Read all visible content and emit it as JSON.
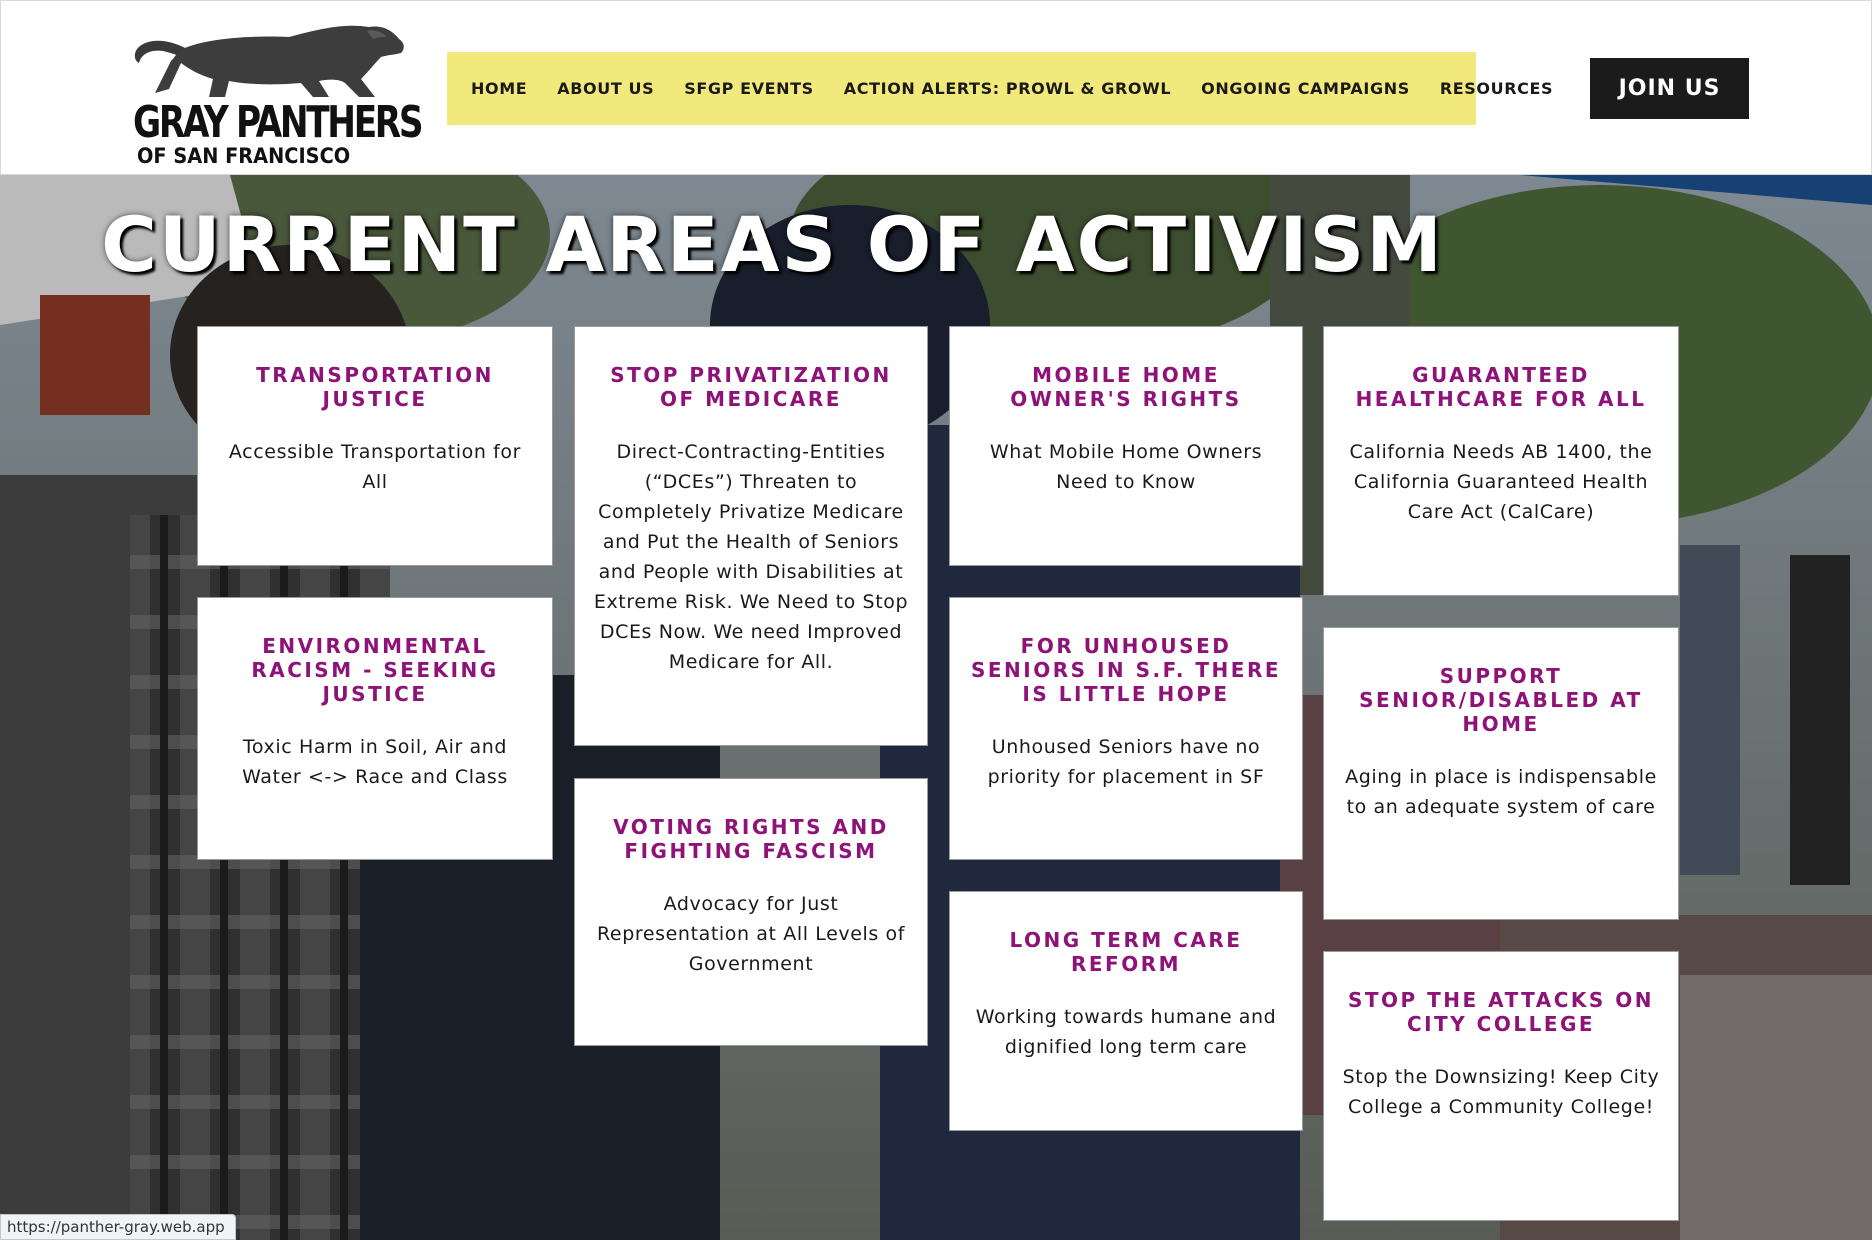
{
  "logo": {
    "line1": "GRAY PANTHERS",
    "line2": "OF SAN FRANCISCO",
    "icon": "panther-icon"
  },
  "nav": {
    "items": [
      {
        "label": "HOME"
      },
      {
        "label": "ABOUT US"
      },
      {
        "label": "SFGP EVENTS"
      },
      {
        "label": "ACTION ALERTS: PROWL & GROWL"
      },
      {
        "label": "ONGOING CAMPAIGNS"
      },
      {
        "label": "RESOURCES"
      }
    ],
    "background": "#f2e97c"
  },
  "join_button": {
    "label": "JOIN US"
  },
  "hero": {
    "title": "CURRENT AREAS OF ACTIVISM"
  },
  "cards": [
    {
      "title": "TRANSPORTATION JUSTICE",
      "text": "Accessible Transportation for All"
    },
    {
      "title": "STOP PRIVATIZATION OF MEDICARE",
      "text": "Direct-Contracting-Entities (“DCEs”) Threaten to Completely Privatize Medicare and Put the Health of Seniors and People with Disabilities at Extreme Risk. We Need to Stop DCEs Now. We need Improved Medicare for All."
    },
    {
      "title": "MOBILE HOME OWNER'S RIGHTS",
      "text": "What Mobile Home Owners Need to Know"
    },
    {
      "title": "GUARANTEED HEALTHCARE FOR ALL",
      "text": "California Needs AB 1400, the California Guaranteed Health Care Act (CalCare)"
    },
    {
      "title": "ENVIRONMENTAL RACISM - SEEKING JUSTICE",
      "text": "Toxic Harm in Soil, Air and Water <-> Race and Class"
    },
    {
      "title": "VOTING RIGHTS AND FIGHTING FASCISM",
      "text": "Advocacy for Just Representation at All Levels of Government"
    },
    {
      "title": "FOR UNHOUSED SENIORS IN S.F. THERE IS LITTLE HOPE",
      "text": "Unhoused Seniors have no priority for placement in SF"
    },
    {
      "title": "SUPPORT SENIOR/DISABLED AT HOME",
      "text": "Aging in place is indispensable to an adequate system of care"
    },
    {
      "title": "LONG TERM CARE REFORM",
      "text": "Working towards humane and dignified long term care"
    },
    {
      "title": "STOP THE ATTACKS ON CITY COLLEGE",
      "text": "Stop the Downsizing! Keep City College a Community College!"
    }
  ],
  "colors": {
    "card_title": "#8e1277",
    "join_bg": "#1b1b1b"
  },
  "status_url": "https://panther-gray.web.app"
}
